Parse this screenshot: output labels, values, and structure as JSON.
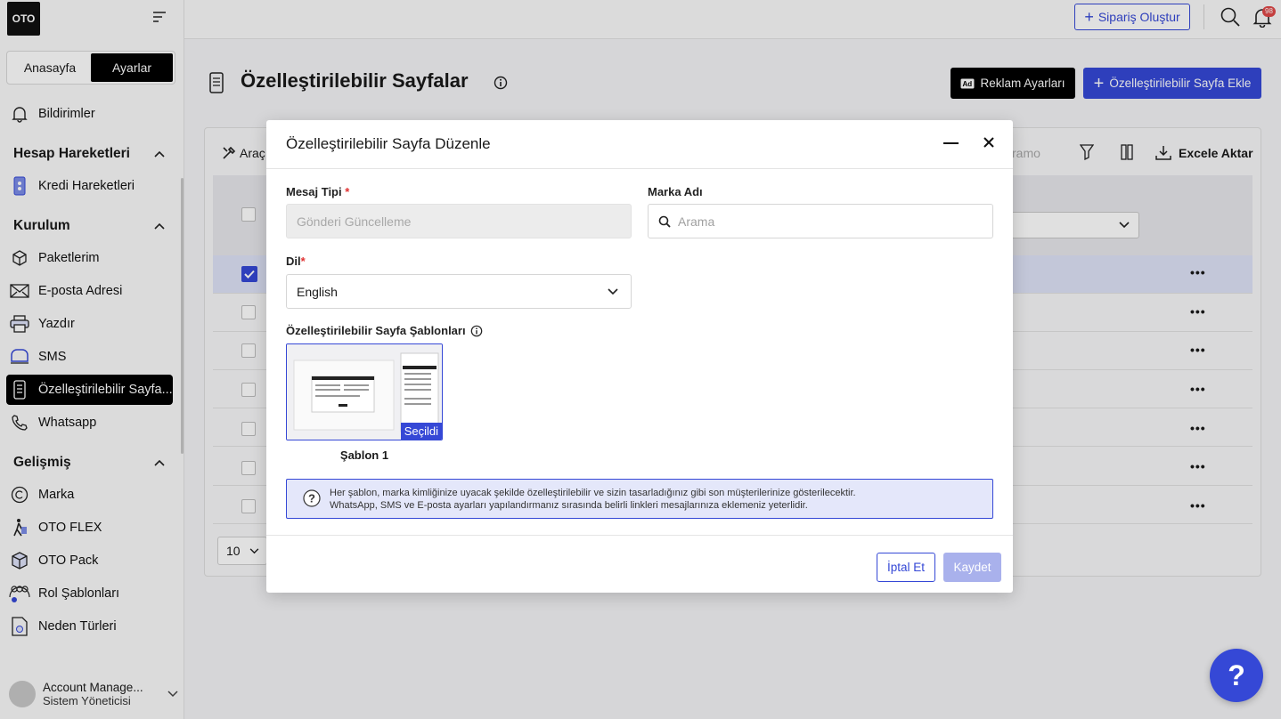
{
  "brand": {
    "logo": "OTO"
  },
  "sidebar": {
    "tabs": [
      {
        "label": "Anasayfa"
      },
      {
        "label": "Ayarlar"
      }
    ],
    "notifications": "Bildirimler",
    "sections": [
      {
        "title": "Hesap Hareketleri",
        "items": [
          {
            "label": "Kredi Hareketleri",
            "icon": "credit-icon"
          }
        ]
      },
      {
        "title": "Kurulum",
        "items": [
          {
            "label": "Paketlerim",
            "icon": "box-icon"
          },
          {
            "label": "E-posta Adresi",
            "icon": "mail-icon"
          },
          {
            "label": "Yazdır",
            "icon": "printer-icon"
          },
          {
            "label": "SMS",
            "icon": "sms-icon"
          },
          {
            "label": "Özelleştirilebilir Sayfa...",
            "icon": "phone-page-icon"
          },
          {
            "label": "Whatsapp",
            "icon": "phone-icon"
          }
        ]
      },
      {
        "title": "Gelişmiş",
        "items": [
          {
            "label": "Marka",
            "icon": "copyright-icon"
          },
          {
            "label": "OTO FLEX",
            "icon": "walker-icon"
          },
          {
            "label": "OTO Pack",
            "icon": "package-icon"
          },
          {
            "label": "Rol Şablonları",
            "icon": "users-icon"
          },
          {
            "label": "Neden Türleri",
            "icon": "document-icon"
          }
        ]
      }
    ],
    "account": {
      "name": "Account Manage...",
      "role": "Sistem Yöneticisi"
    }
  },
  "topbar": {
    "order_button": "Sipariş Oluştur",
    "notification_count": "98"
  },
  "page": {
    "title": "Özelleştirilebilir Sayfalar",
    "ad_button": "Reklam Ayarları",
    "add_button": "Özelleştirilebilir Sayfa Ekle",
    "toolbar": {
      "tools": "Araç",
      "search_placeholder": "ramo",
      "export": "Excele Aktar"
    },
    "page_size": "10"
  },
  "modal": {
    "title": "Özelleştirilebilir Sayfa Düzenle",
    "message_type": {
      "label": "Mesaj Tipi",
      "required": "*",
      "value": "Gönderi Güncelleme"
    },
    "brand_name": {
      "label": "Marka Adı",
      "placeholder": "Arama"
    },
    "language": {
      "label": "Dil",
      "required": "*",
      "value": "English"
    },
    "templates": {
      "label": "Özelleştirilebilir Sayfa Şablonları",
      "items": [
        {
          "name": "Şablon 1",
          "badge": "Seçildi"
        }
      ]
    },
    "note_line1": "Her şablon, marka kimliğinize uyacak şekilde özelleştirilebilir ve sizin tasarladığınız gibi son müşterilerinize gösterilecektir.",
    "note_line2": "WhatsApp, SMS ve E-posta ayarları yapılandırmanız sırasında belirli linkleri mesajlarınıza eklemeniz yeterlidir.",
    "cancel": "İptal Et",
    "save": "Kaydet"
  },
  "help": "?",
  "colors": {
    "accent": "#3548d6",
    "dark": "#000000",
    "danger": "#e03131"
  }
}
